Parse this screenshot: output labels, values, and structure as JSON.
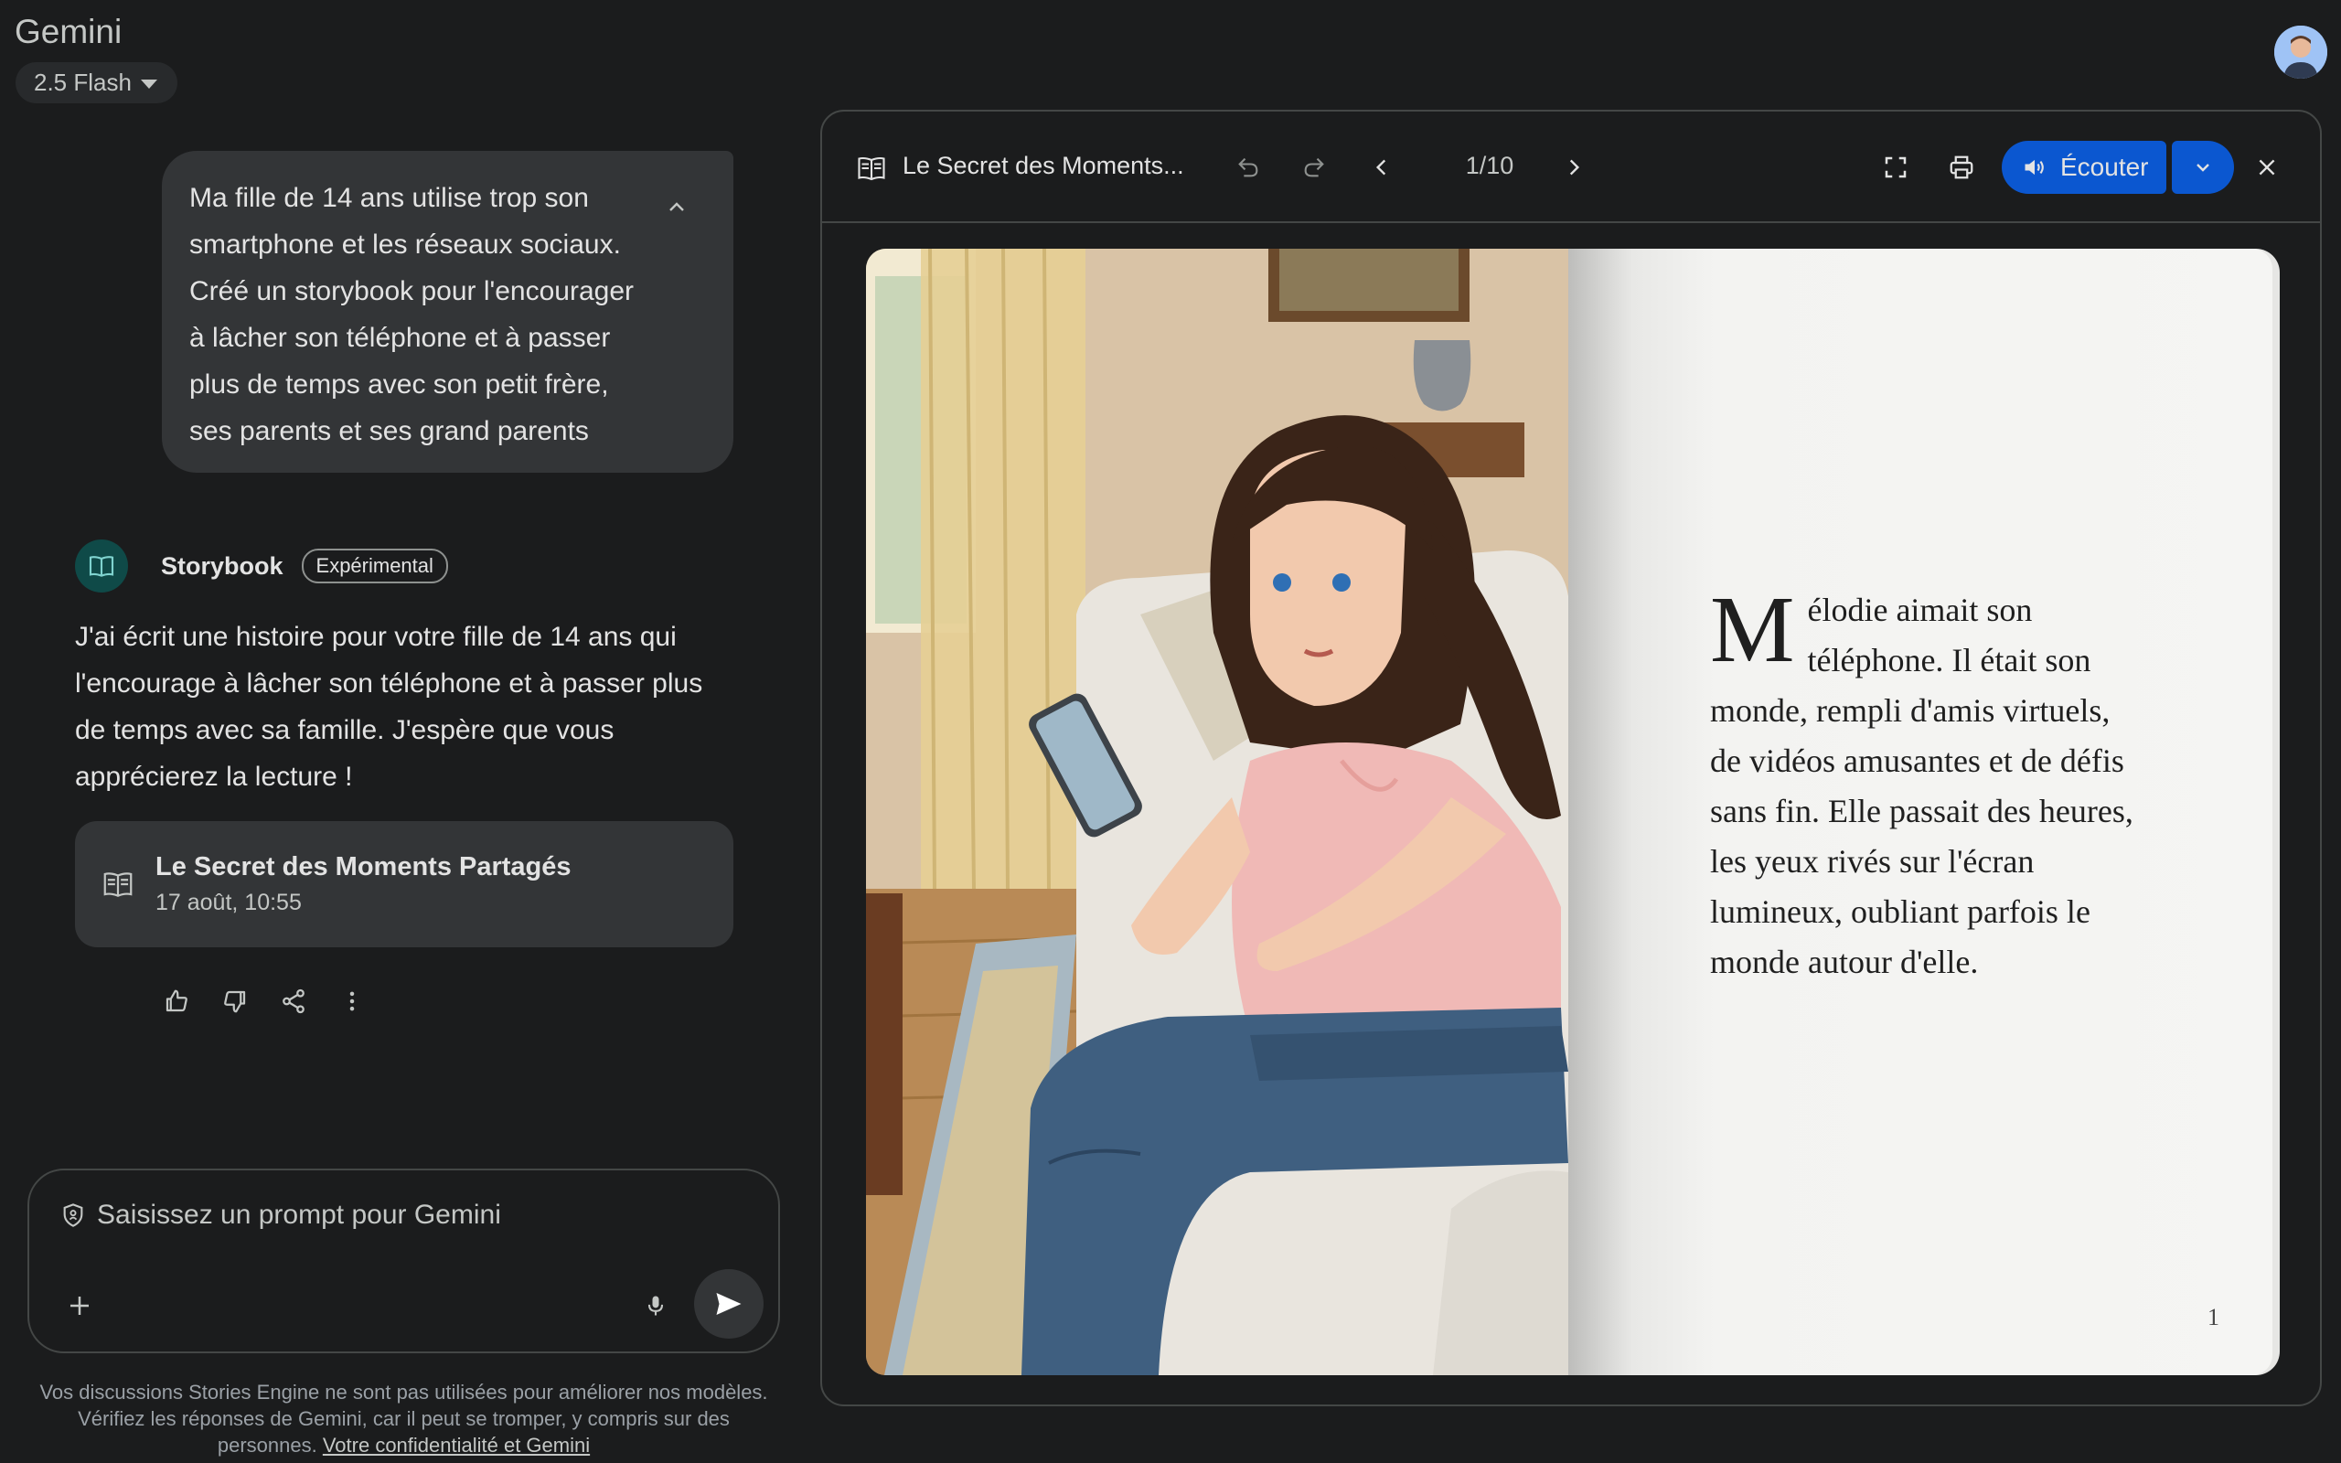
{
  "app": {
    "title": "Gemini",
    "model": "2.5 Flash"
  },
  "user_message": {
    "lines": [
      "Ma fille de 14 ans utilise trop son",
      "smartphone et les réseaux sociaux.",
      "Créé un storybook pour l'encourager",
      "à lâcher son téléphone et à passer",
      "plus de temps avec son petit frère,",
      "ses parents et ses grand parents"
    ]
  },
  "assistant": {
    "name": "Storybook",
    "badge": "Expérimental",
    "response_lines": [
      "J'ai écrit une histoire pour votre fille de 14 ans qui",
      "l'encourage à lâcher son téléphone et à passer plus",
      "de temps avec sa famille. J'espère que vous",
      "apprécierez la lecture !"
    ],
    "card": {
      "title": "Le Secret des Moments Partagés",
      "date": "17 août, 10:55"
    }
  },
  "composer": {
    "placeholder": "Saisissez un prompt pour Gemini"
  },
  "disclaimer": {
    "line1": "Vos discussions Stories Engine ne sont pas utilisées pour améliorer nos modèles.",
    "line2": "Vérifiez les réponses de Gemini, car il peut se tromper, y compris sur des",
    "line3_prefix": "personnes.",
    "link": "Votre confidentialité et Gemini"
  },
  "viewer": {
    "title": "Le Secret des Moments...",
    "page_indicator": "1/10",
    "listen_label": "Écouter",
    "story": {
      "dropcap": "M",
      "text": "élodie aimait son téléphone. Il était son monde, rempli d'amis virtuels, de vidéos amusantes et de défis sans fin. Elle passait des heures, les yeux rivés sur l'écran lumineux, oubliant parfois le monde autour d'elle.",
      "page_number": "1"
    }
  },
  "colors": {
    "background": "#1b1c1d",
    "surface": "#333537",
    "accent": "#0b57d0",
    "page": "#f5f5f3"
  }
}
